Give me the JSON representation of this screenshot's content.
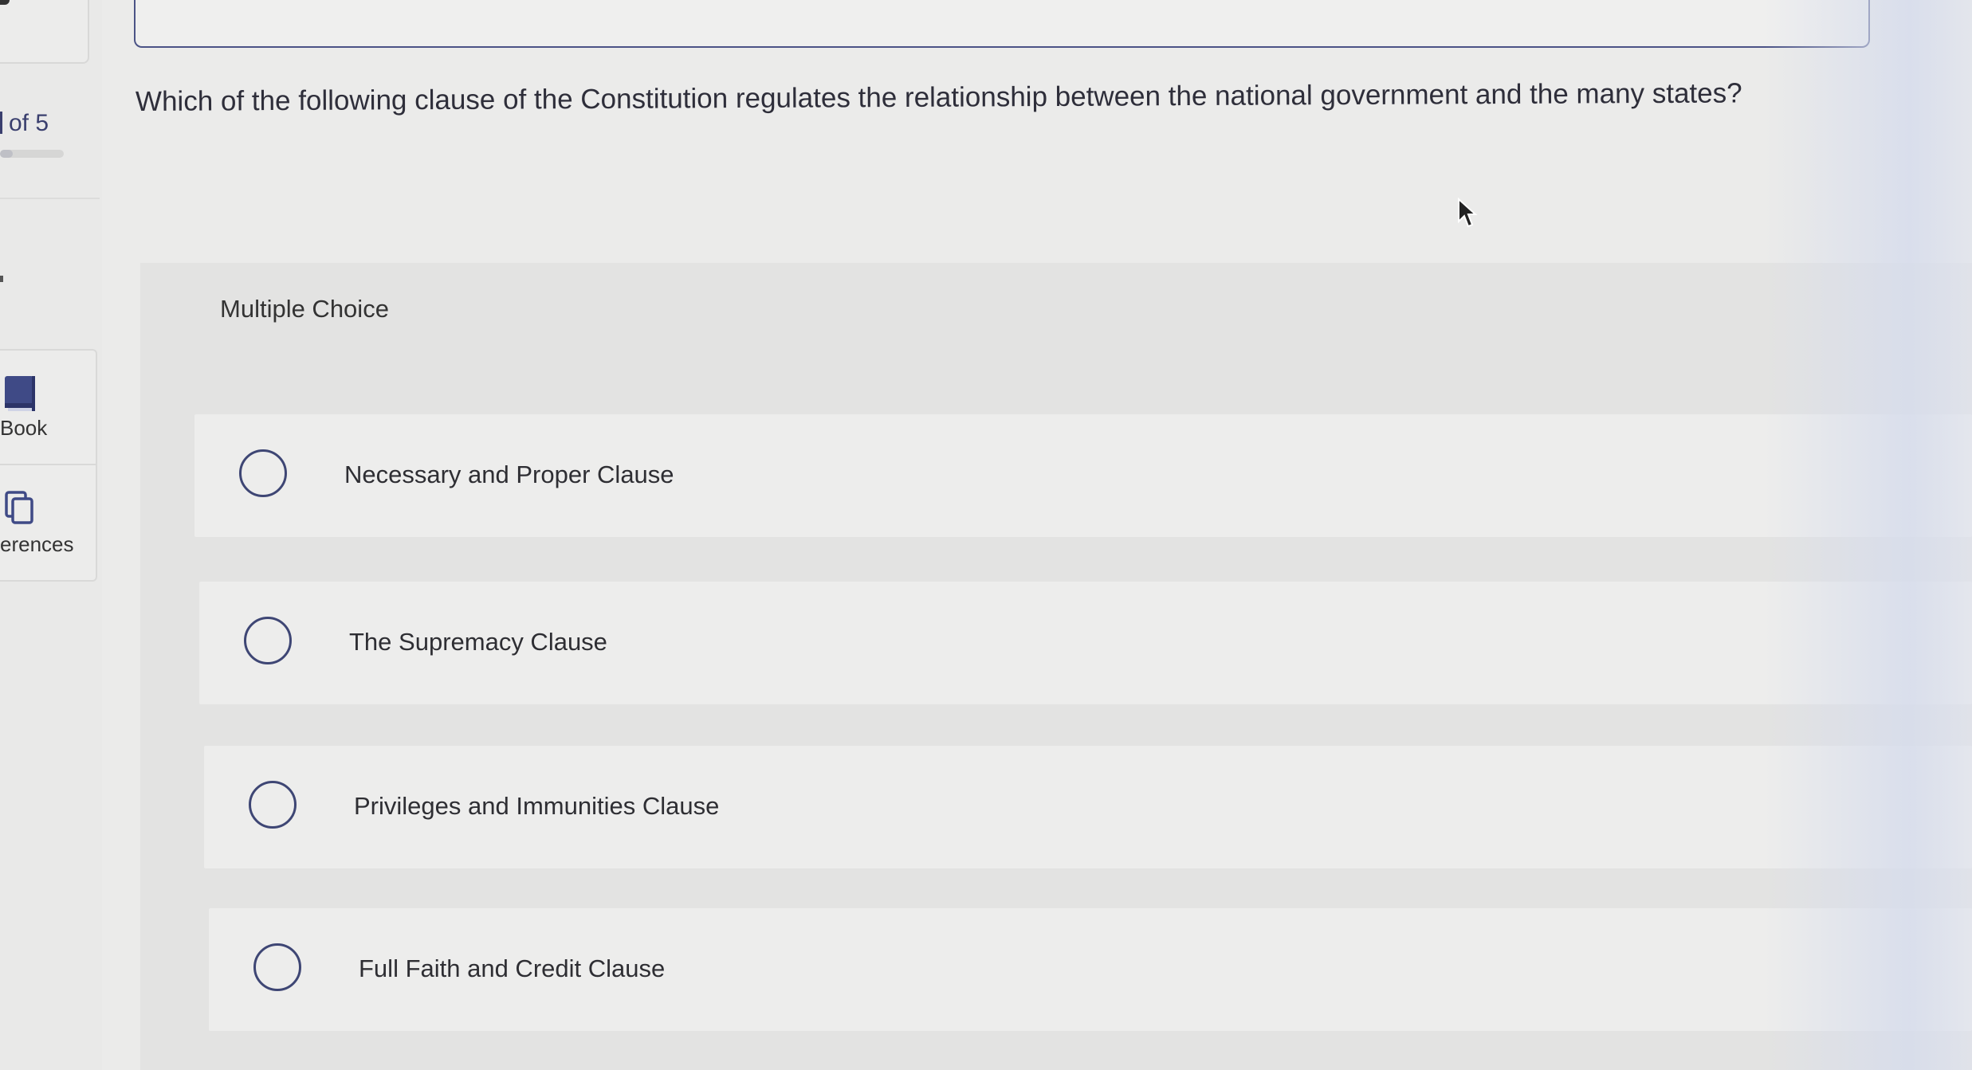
{
  "sidebar": {
    "progress_text": "of 5",
    "progress_fraction": 0.2,
    "tools": [
      {
        "label": "Book",
        "icon": "book-icon"
      },
      {
        "label": "erences",
        "icon": "references-icon"
      }
    ]
  },
  "question": {
    "text": "Which of the following clause of the Constitution regulates the relationship between the national government and the many states?"
  },
  "answer": {
    "type_label": "Multiple Choice",
    "choices": [
      {
        "label": "Necessary and Proper Clause"
      },
      {
        "label": "The Supremacy Clause"
      },
      {
        "label": "Privileges and Immunities Clause"
      },
      {
        "label": "Full Faith and Credit Clause"
      }
    ]
  },
  "colors": {
    "accent": "#3e4674",
    "background": "#ebebea",
    "panel": "#e3e3e2",
    "choice_background": "#ededec"
  }
}
